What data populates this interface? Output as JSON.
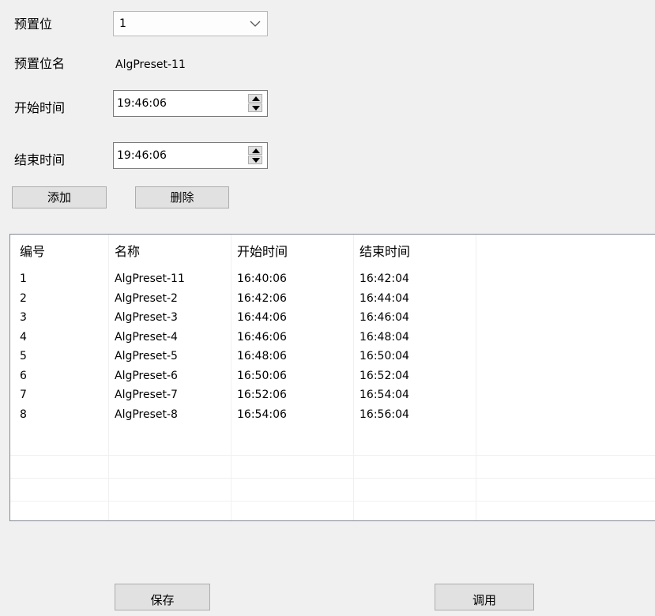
{
  "form": {
    "preset_label": "预置位",
    "preset_value": "1",
    "preset_name_label": "预置位名",
    "preset_name_value": "AlgPreset-11",
    "start_time_label": "开始时间",
    "start_time_value": "19:46:06",
    "end_time_label": "结束时间",
    "end_time_value": "19:46:06"
  },
  "buttons": {
    "add": "添加",
    "delete": "删除",
    "save": "保存",
    "invoke": "调用"
  },
  "table": {
    "columns": [
      "编号",
      "名称",
      "开始时间",
      "结束时间"
    ],
    "rows": [
      [
        "1",
        "AlgPreset-11",
        "16:40:06",
        "16:42:04"
      ],
      [
        "2",
        "AlgPreset-2",
        "16:42:06",
        "16:44:04"
      ],
      [
        "3",
        "AlgPreset-3",
        "16:44:06",
        "16:46:04"
      ],
      [
        "4",
        "AlgPreset-4",
        "16:46:06",
        "16:48:04"
      ],
      [
        "5",
        "AlgPreset-5",
        "16:48:06",
        "16:50:04"
      ],
      [
        "6",
        "AlgPreset-6",
        "16:50:06",
        "16:52:04"
      ],
      [
        "7",
        "AlgPreset-7",
        "16:52:06",
        "16:54:04"
      ],
      [
        "8",
        "AlgPreset-8",
        "16:54:06",
        "16:56:04"
      ]
    ]
  },
  "icons": {
    "dropdown": "chevron-down-icon",
    "spin_up": "spin-up-icon",
    "spin_down": "spin-down-icon"
  }
}
